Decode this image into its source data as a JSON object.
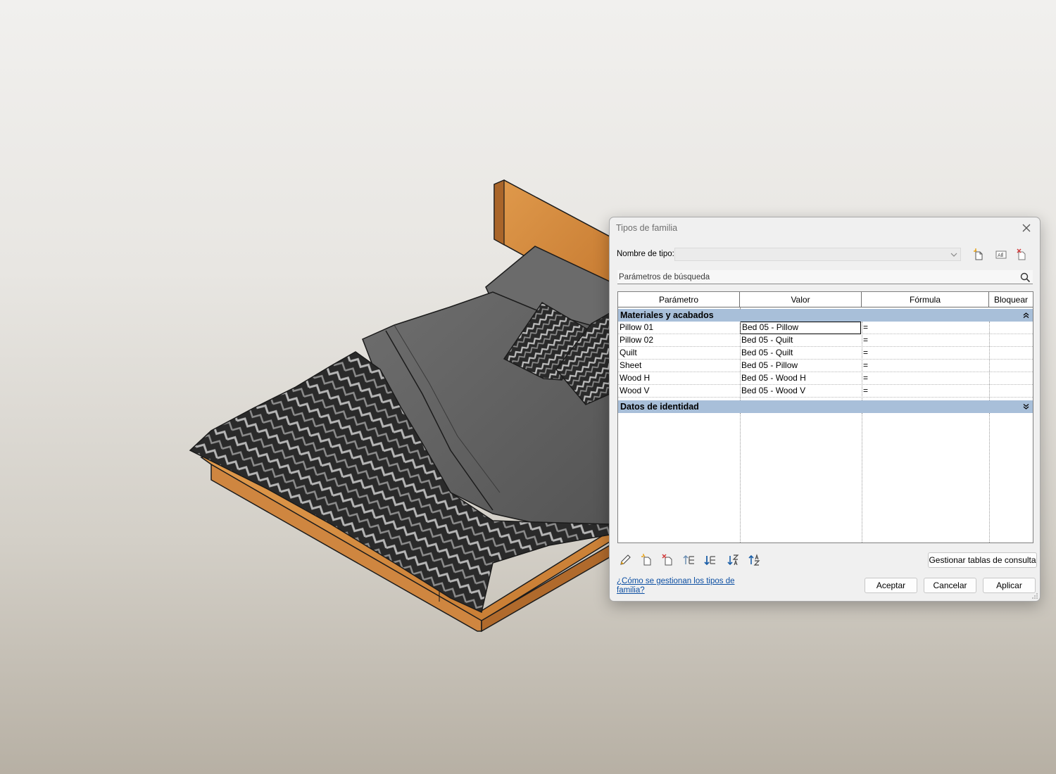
{
  "dialog": {
    "title": "Tipos de familia",
    "type_name_label": "Nombre de tipo:",
    "type_name_value": "",
    "search_placeholder": "Parámetros de búsqueda",
    "columns": [
      "Parámetro",
      "Valor",
      "Fórmula",
      "Bloquear"
    ],
    "groups": [
      {
        "name": "Materiales y acabados",
        "expanded": true,
        "rows": [
          {
            "param": "Pillow  01",
            "value": "Bed 05 - Pillow",
            "formula": "=",
            "lock": ""
          },
          {
            "param": "Pillow 02",
            "value": "Bed 05 - Quilt",
            "formula": "=",
            "lock": ""
          },
          {
            "param": "Quilt",
            "value": "Bed 05 - Quilt",
            "formula": "=",
            "lock": ""
          },
          {
            "param": "Sheet",
            "value": "Bed 05 - Pillow",
            "formula": "=",
            "lock": ""
          },
          {
            "param": "Wood H",
            "value": "Bed 05 - Wood H",
            "formula": "=",
            "lock": ""
          },
          {
            "param": "Wood V",
            "value": "Bed 05 - Wood V",
            "formula": "=",
            "lock": ""
          }
        ]
      },
      {
        "name": "Datos de identidad",
        "expanded": false,
        "rows": []
      }
    ],
    "manage_lookup_button": "Gestionar tablas de consulta",
    "help_link": "¿Cómo se gestionan los tipos de familia?",
    "ok_button": "Aceptar",
    "cancel_button": "Cancelar",
    "apply_button": "Aplicar",
    "toolbar_icons": [
      "new-type-icon",
      "rename-type-icon",
      "delete-type-icon"
    ],
    "bottom_icons": [
      "edit-parameter-icon",
      "new-parameter-icon",
      "delete-parameter-icon",
      "move-up-icon",
      "move-down-icon",
      "sort-ascending-icon",
      "sort-descending-icon"
    ]
  },
  "colors": {
    "group_header": "#a8bfd9",
    "link": "#0b4ea2",
    "wood": "#d48a3e",
    "fabric": "#5b5b5b",
    "pattern": "#2d2d2d"
  }
}
